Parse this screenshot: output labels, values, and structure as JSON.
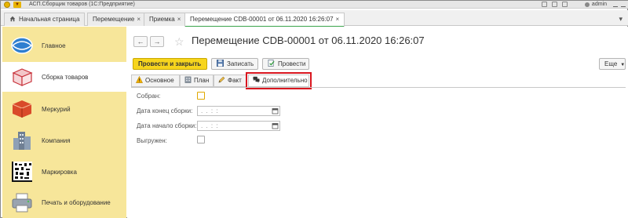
{
  "window": {
    "title": "АСП.Сборщик товаров (1С:Предприятие)",
    "user": "admin"
  },
  "tabs": [
    {
      "label": "Начальная страница",
      "closable": false,
      "active": false
    },
    {
      "label": "Перемещение",
      "closable": true,
      "active": false
    },
    {
      "label": "Приемка",
      "closable": true,
      "active": false
    },
    {
      "label": "Перемещение CDB-00001 от 06.11.2020 16:26:07",
      "closable": true,
      "active": true
    }
  ],
  "tab_close_glyph": "×",
  "sidebar": {
    "items": [
      {
        "label": "Главное",
        "icon": "globe-icon",
        "active": false
      },
      {
        "label": "Сборка товаров",
        "icon": "box-icon",
        "active": true
      },
      {
        "label": "Меркурий",
        "icon": "mercury-icon",
        "active": false
      },
      {
        "label": "Компания",
        "icon": "buildings-icon",
        "active": false
      },
      {
        "label": "Маркировка",
        "icon": "datamatrix-icon",
        "active": false
      },
      {
        "label": "Печать и оборудование",
        "icon": "printer-icon",
        "active": false
      }
    ]
  },
  "document": {
    "title": "Перемещение CDB-00001 от 06.11.2020 16:26:07",
    "nav_back": "←",
    "nav_forward": "→",
    "favorite": "☆"
  },
  "toolbar": {
    "post_close_label": "Провести и закрыть",
    "save_label": "Записать",
    "post_label": "Провести",
    "more_label": "Еще"
  },
  "form_tabs": [
    {
      "label": "Основное",
      "icon": "warning-icon",
      "active": false
    },
    {
      "label": "План",
      "icon": "building-icon",
      "active": false
    },
    {
      "label": "Факт",
      "icon": "pencil-icon",
      "active": false
    },
    {
      "label": "Дополнительно",
      "icon": "comments-icon",
      "active": true
    }
  ],
  "fields": {
    "collected_label": "Собран:",
    "collected_value": false,
    "end_date_label": "Дата конец сборки:",
    "end_date_value": ". .    : :",
    "start_date_label": "Дата начало сборки:",
    "start_date_value": ". .    : :",
    "unloaded_label": "Выгружен:",
    "unloaded_value": false
  },
  "colors": {
    "sidebar_bg": "#f7e69a",
    "primary_button": "#f7d51d",
    "active_tab_indicator": "#3aa44b",
    "highlight_outline": "#d9161f"
  }
}
